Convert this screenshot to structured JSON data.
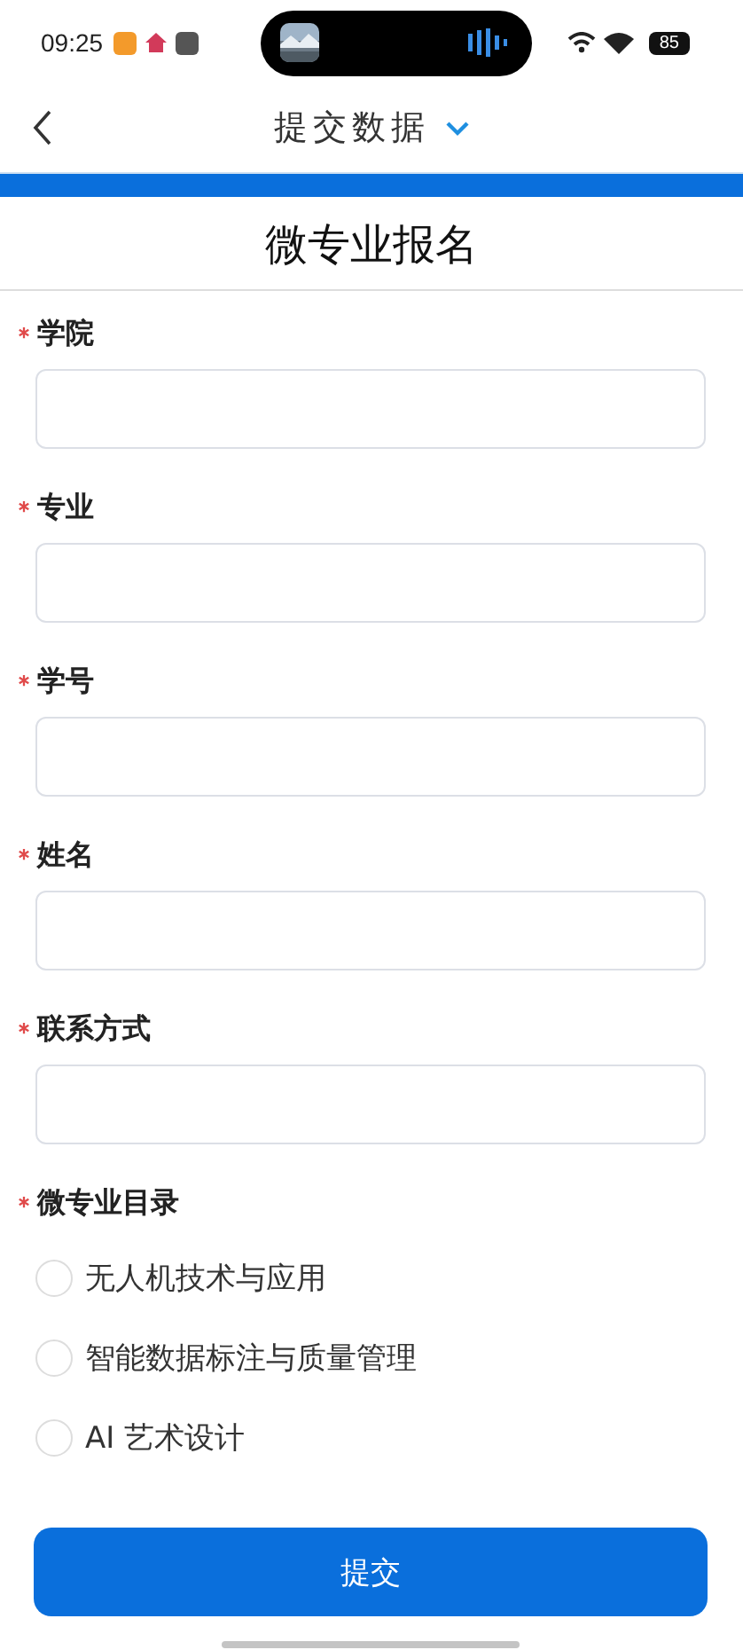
{
  "status_bar": {
    "time": "09:25",
    "battery": "85"
  },
  "nav": {
    "title": "提交数据"
  },
  "form": {
    "title": "微专业报名",
    "fields": [
      {
        "label": "学院",
        "required": true
      },
      {
        "label": "专业",
        "required": true
      },
      {
        "label": "学号",
        "required": true
      },
      {
        "label": "姓名",
        "required": true
      },
      {
        "label": "联系方式",
        "required": true
      }
    ],
    "choice": {
      "label": "微专业目录",
      "required": true,
      "options": [
        {
          "label": "无人机技术与应用",
          "selected": false
        },
        {
          "label": "智能数据标注与质量管理",
          "selected": false
        },
        {
          "label": "AI 艺术设计",
          "selected": false
        }
      ]
    }
  },
  "submit": "提交"
}
